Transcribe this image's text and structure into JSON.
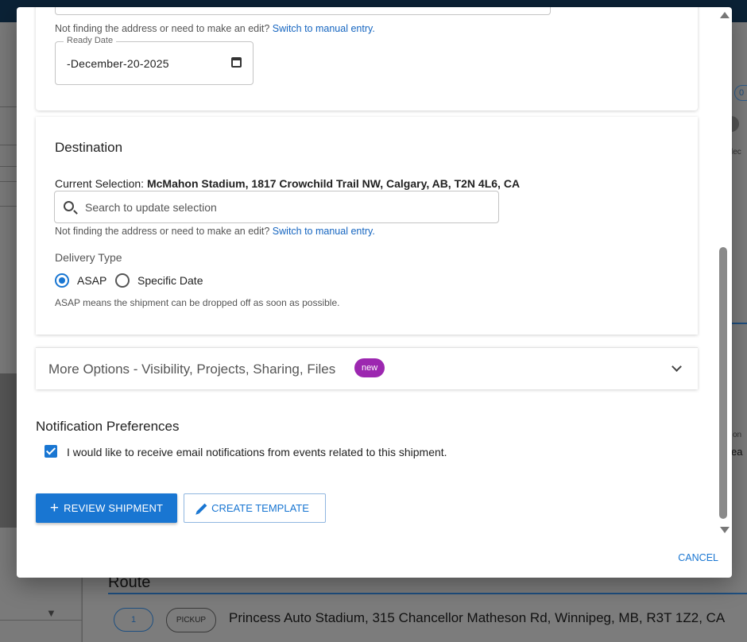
{
  "background": {
    "chip_text": "0",
    "side_text_1": "lec",
    "side_text_2": "on",
    "side_text_3": "ea",
    "route_title": "Route",
    "stop": {
      "number": "1",
      "type": "PICKUP",
      "address": "Princess Auto Stadium, 315 Chancellor Matheson Rd, Winnipeg, MB, R3T 1Z2, CA"
    }
  },
  "origin": {
    "hint_text": "Not finding the address or need to make an edit?",
    "hint_link": "Switch to manual entry.",
    "ready_date_label": "Ready Date",
    "ready_date_value": "-December-20-2025",
    "calendar_icon": "calendar-icon"
  },
  "destination": {
    "title": "Destination",
    "current_selection_label": "Current Selection:",
    "current_selection_value": "McMahon Stadium, 1817 Crowchild Trail NW, Calgary, AB, T2N 4L6, CA",
    "search_placeholder": "Search to update selection",
    "search_icon": "search-icon",
    "hint_text": "Not finding the address or need to make an edit?",
    "hint_link": "Switch to manual entry.",
    "delivery_type_label": "Delivery Type",
    "options": [
      {
        "label": "ASAP",
        "selected": true
      },
      {
        "label": "Specific Date",
        "selected": false
      }
    ],
    "asap_note": "ASAP means the shipment can be dropped off as soon as possible."
  },
  "more_options": {
    "title": "More Options - Visibility, Projects, Sharing, Files",
    "badge": "new",
    "badge_color": "#9c27b0"
  },
  "notifications": {
    "title": "Notification Preferences",
    "checkbox_label": "I would like to receive email notifications from events related to this shipment.",
    "checked": true
  },
  "actions": {
    "review_label": "REVIEW SHIPMENT",
    "template_label": "CREATE TEMPLATE",
    "cancel_label": "CANCEL"
  },
  "colors": {
    "primary": "#1976d2",
    "topbar": "#0b2236"
  }
}
